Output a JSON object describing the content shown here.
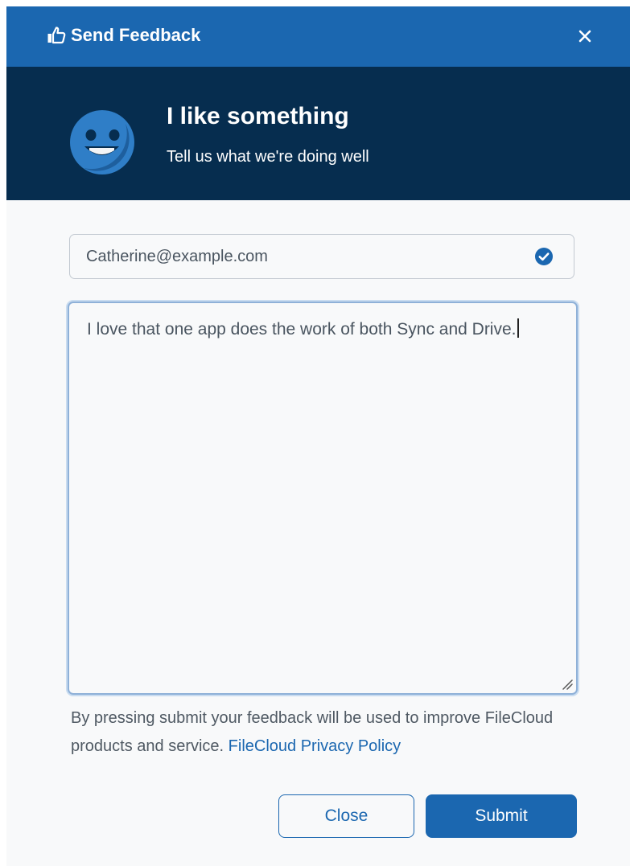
{
  "titlebar": {
    "title": "Send Feedback",
    "title_icon": "thumbs-up-icon",
    "close_icon": "close-icon"
  },
  "hero": {
    "icon": "smiley-face-icon",
    "title": "I like something",
    "subtitle": "Tell us what we're doing well"
  },
  "form": {
    "email_value": "Catherine@example.com",
    "email_status_icon": "check-circle-icon",
    "message_value": "I love that one app does the work of both Sync and Drive."
  },
  "notice": {
    "text": "By pressing submit your feedback will be used to improve FileCloud products and service. ",
    "link_text": "FileCloud Privacy Policy"
  },
  "buttons": {
    "close_label": "Close",
    "submit_label": "Submit"
  },
  "colors": {
    "titlebar": "#1b67b0",
    "hero": "#062d4f",
    "accent": "#1b67b0",
    "smiley": "#2f7ec7"
  }
}
